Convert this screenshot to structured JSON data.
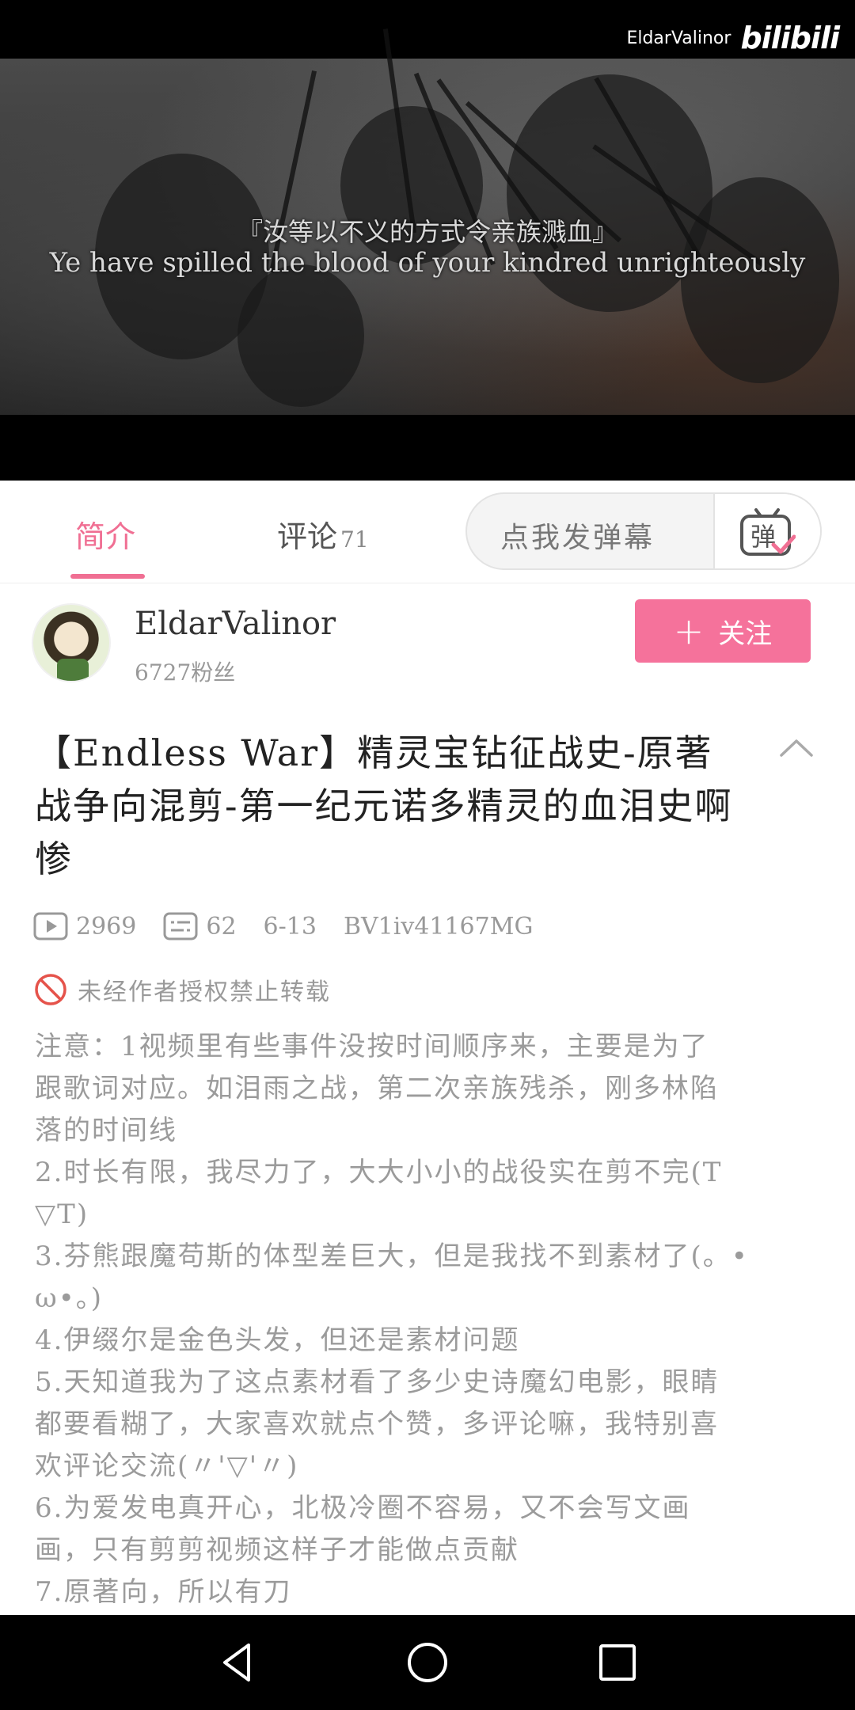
{
  "player": {
    "watermark_user": "EldarValinor",
    "watermark_logo": "bilibili",
    "subtitle_cn": "『汝等以不义的方式令亲族溅血』",
    "subtitle_en": "Ye have spilled the blood of your kindred unrighteously"
  },
  "tabs": {
    "intro_label": "简介",
    "comments_label": "评论",
    "comments_count": "71",
    "danmaku_placeholder": "点我发弹幕",
    "danmaku_icon_glyph": "弹"
  },
  "uploader": {
    "name": "EldarValinor",
    "fans": "6727粉丝",
    "follow_label": "关注"
  },
  "video": {
    "title": "【Endless War】精灵宝钻征战史-原著战争向混剪-第一纪元诺多精灵的血泪史啊惨",
    "views": "2969",
    "danmaku_count": "62",
    "date": "6-13",
    "bvid": "BV1iv41167MG",
    "copyright_notice": "未经作者授权禁止转载"
  },
  "description_lines": [
    "注意：1视频里有些事件没按时间顺序来，主要是为了",
    "跟歌词对应。如泪雨之战，第二次亲族残杀，刚多林陷",
    "落的时间线",
    "2.时长有限，我尽力了，大大小小的战役实在剪不完(T",
    "▽T)",
    "3.芬熊跟魔苟斯的体型差巨大，但是我找不到素材了(。•",
    "ω•。)",
    "4.伊缀尔是金色头发，但还是素材问题",
    "5.天知道我为了这点素材看了多少史诗魔幻电影，眼睛",
    "都要看糊了，大家喜欢就点个赞，多评论嘛，我特别喜",
    "欢评论交流(〃'▽'〃)",
    "6.为爱发电真开心，北极冷圈不容易，又不会写文画",
    "画，只有剪剪视频这样子才能做点贡献",
    "7.原著向，所以有刀"
  ],
  "colors": {
    "accent": "#f06f93",
    "follow_button": "#f5729b",
    "muted_text": "#9b9b9b"
  },
  "icons": {
    "play": "play-count-icon",
    "danmaku": "danmaku-count-icon",
    "forbid": "forbid-icon",
    "collapse": "chevron-up-icon"
  }
}
